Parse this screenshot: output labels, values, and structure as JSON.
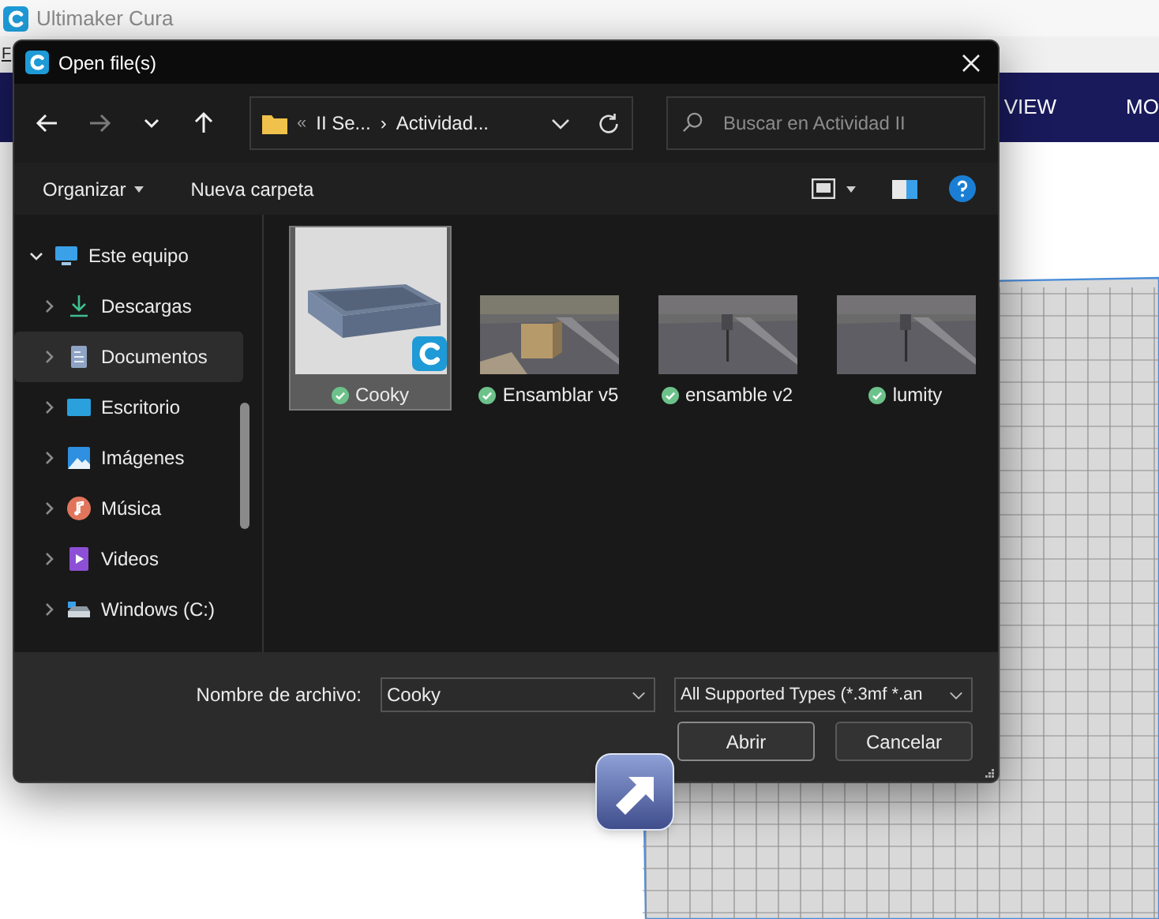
{
  "app": {
    "title": "Ultimaker Cura",
    "menu": [
      "F"
    ],
    "header_tabs": [
      "VIEW",
      "MO"
    ]
  },
  "dialog": {
    "title": "Open file(s)",
    "nav_buttons": [
      {
        "kind": "back",
        "disabled": false
      },
      {
        "kind": "forward",
        "disabled": true
      },
      {
        "kind": "recent",
        "disabled": false
      },
      {
        "kind": "up",
        "disabled": false
      }
    ],
    "address": {
      "overflow": "«",
      "segments": [
        "II Se...",
        "Actividad..."
      ],
      "separator": "›"
    },
    "search": {
      "placeholder": "Buscar en Actividad II"
    },
    "toolbar": [
      "Organizar",
      "Nueva carpeta"
    ],
    "nav_tree": [
      {
        "label": "Este equipo",
        "kind": "pc",
        "expanded": true,
        "selected": false,
        "children": [
          {
            "label": "Descargas",
            "kind": "downloads",
            "expanded": false,
            "selected": false
          },
          {
            "label": "Documentos",
            "kind": "documents",
            "expanded": false,
            "selected": true
          },
          {
            "label": "Escritorio",
            "kind": "desktop",
            "expanded": false,
            "selected": false
          },
          {
            "label": "Imágenes",
            "kind": "pictures",
            "expanded": false,
            "selected": false
          },
          {
            "label": "Música",
            "kind": "music",
            "expanded": false,
            "selected": false
          },
          {
            "label": "Videos",
            "kind": "videos",
            "expanded": false,
            "selected": false
          },
          {
            "label": "Windows (C:)",
            "kind": "drive",
            "expanded": false,
            "selected": false
          }
        ]
      }
    ],
    "files": [
      {
        "name": "Cooky",
        "kind": "model",
        "synced": true,
        "selected": true
      },
      {
        "name": "Ensamblar v5",
        "synced": true,
        "selected": false
      },
      {
        "name": "ensamble v2",
        "synced": true,
        "selected": false
      },
      {
        "name": "lumity",
        "synced": true,
        "selected": false
      }
    ],
    "filename": {
      "label": "Nombre de archivo:",
      "value": "Cooky"
    },
    "filetype": {
      "value": "All Supported Types (*.3mf *.an"
    },
    "buttons": [
      "Abrir",
      "Cancelar"
    ]
  }
}
